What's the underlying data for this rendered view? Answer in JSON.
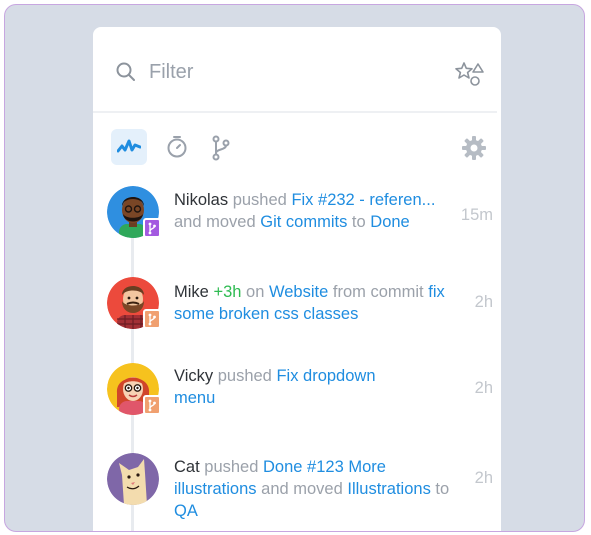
{
  "filter": {
    "placeholder": "Filter"
  },
  "icons": {
    "search": "search-icon",
    "shapes": "shapes-filter-icon",
    "activity": "activity-icon",
    "timer": "timer-icon",
    "branch": "git-branch-icon",
    "settings": "gear-icon"
  },
  "colors": {
    "background": "#d6dce6",
    "border": "#c7a6e0",
    "link": "#1f8de0",
    "added_time": "#2fbb52",
    "muted": "#9ba1aa",
    "active_tab_bg": "#e4f0fb"
  },
  "feed": [
    {
      "actor": "Nikolas",
      "verb": "pushed",
      "target": "Fix #232 - referen...",
      "mid": "and moved",
      "target2": "Git commits",
      "conj": "to",
      "target3": "Done",
      "time": "15m",
      "badge_color": "#a35ae0"
    },
    {
      "actor": "Mike",
      "added": "+3h",
      "prep": "on",
      "target": "Website",
      "mid": "from commit",
      "target2": "fix some broken css classes",
      "time": "2h",
      "badge_color": "#f0a070"
    },
    {
      "actor": "Vicky",
      "verb": "pushed",
      "target": "Fix dropdown menu",
      "time": "2h",
      "badge_color": "#f0a070"
    },
    {
      "actor": "Cat",
      "verb": "pushed",
      "target": "Done #123 More illustrations",
      "mid": "and moved",
      "target2": "Illustrations",
      "conj": "to",
      "target3": "QA",
      "time": "2h"
    }
  ]
}
